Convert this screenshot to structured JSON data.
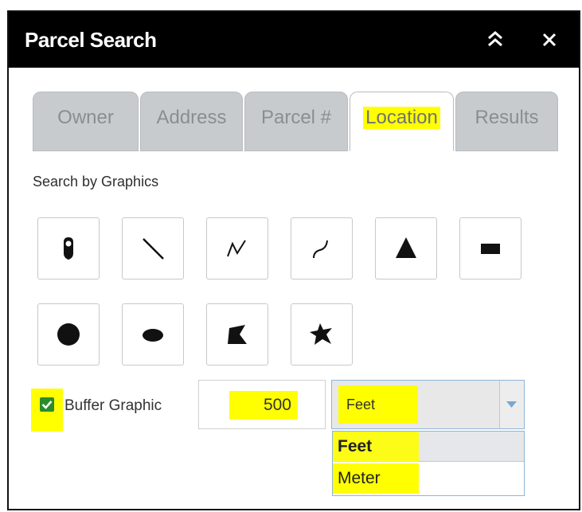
{
  "header": {
    "title": "Parcel Search"
  },
  "tabs": [
    {
      "label": "Owner",
      "active": false
    },
    {
      "label": "Address",
      "active": false
    },
    {
      "label": "Parcel #",
      "active": false
    },
    {
      "label": "Location",
      "active": true
    },
    {
      "label": "Results",
      "active": false
    }
  ],
  "search": {
    "section_label": "Search by Graphics",
    "tools": [
      {
        "icon": "point-icon"
      },
      {
        "icon": "line-icon"
      },
      {
        "icon": "polyline-icon"
      },
      {
        "icon": "freehand-polyline-icon"
      },
      {
        "icon": "triangle-icon"
      },
      {
        "icon": "rectangle-icon"
      },
      {
        "icon": "circle-icon"
      },
      {
        "icon": "ellipse-icon"
      },
      {
        "icon": "polygon-icon"
      },
      {
        "icon": "freehand-polygon-icon"
      }
    ]
  },
  "buffer": {
    "label": "Buffer Graphic",
    "checked": true,
    "distance": "500",
    "unit": "Feet",
    "unit_options": [
      "Feet",
      "Meter"
    ]
  },
  "colors": {
    "highlight": "#ffff00",
    "titlebar": "#000000",
    "checkbox": "#2c8c2c",
    "select_border": "#8fb5d8"
  }
}
